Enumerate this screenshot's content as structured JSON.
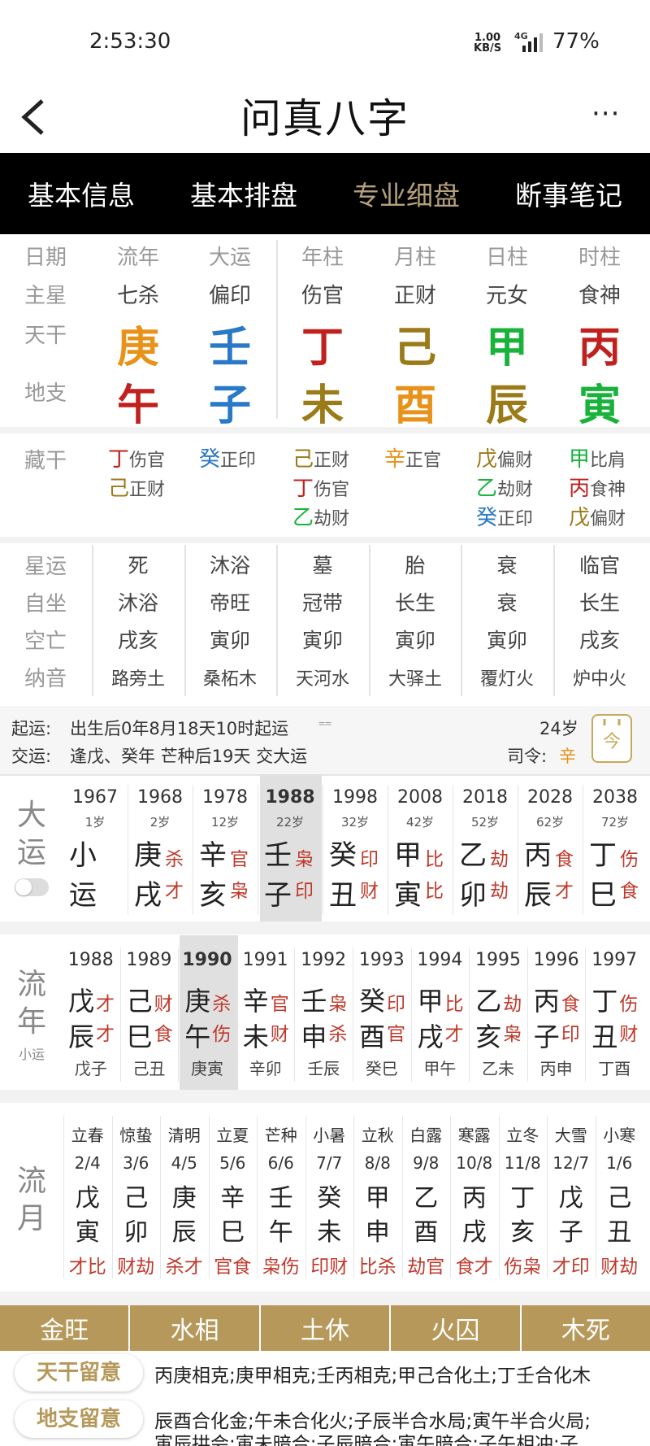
{
  "status": {
    "time": "2:53:30",
    "net_top": "1.00",
    "net_bottom": "KB/S",
    "net_type": "4G",
    "battery": "77%"
  },
  "header": {
    "title": "问真八字",
    "more": "···"
  },
  "tabs": [
    {
      "label": "基本信息"
    },
    {
      "label": "基本排盘"
    },
    {
      "label": "专业细盘"
    },
    {
      "label": "断事笔记"
    }
  ],
  "grid": {
    "labels": {
      "date": "日期",
      "star": "主星",
      "gan": "天干",
      "zhi": "地支"
    },
    "columns": [
      {
        "head": "流年",
        "star": "七杀",
        "gan": "庚",
        "gan_color": "#e8921a",
        "zhi": "午",
        "zhi_color": "#c0211f"
      },
      {
        "head": "大运",
        "star": "偏印",
        "gan": "壬",
        "gan_color": "#2a78c8",
        "zhi": "子",
        "zhi_color": "#2a78c8"
      },
      {
        "head": "年柱",
        "star": "伤官",
        "gan": "丁",
        "gan_color": "#c0211f",
        "zhi": "未",
        "zhi_color": "#9a7b18"
      },
      {
        "head": "月柱",
        "star": "正财",
        "gan": "己",
        "gan_color": "#9a7b18",
        "zhi": "酉",
        "zhi_color": "#e8921a"
      },
      {
        "head": "日柱",
        "star": "元女",
        "gan": "甲",
        "gan_color": "#19b33b",
        "zhi": "辰",
        "zhi_color": "#9a7b18"
      },
      {
        "head": "时柱",
        "star": "食神",
        "gan": "丙",
        "gan_color": "#c0211f",
        "zhi": "寅",
        "zhi_color": "#19b33b"
      }
    ]
  },
  "hidden": {
    "label": "藏干",
    "columns": [
      [
        {
          "g": "丁",
          "c": "#c0211f",
          "s": "伤官"
        },
        {
          "g": "己",
          "c": "#9a7b18",
          "s": "正财"
        }
      ],
      [
        {
          "g": "癸",
          "c": "#2a78c8",
          "s": "正印"
        }
      ],
      [
        {
          "g": "己",
          "c": "#9a7b18",
          "s": "正财"
        },
        {
          "g": "丁",
          "c": "#c0211f",
          "s": "伤官"
        },
        {
          "g": "乙",
          "c": "#19b33b",
          "s": "劫财"
        }
      ],
      [
        {
          "g": "辛",
          "c": "#e8921a",
          "s": "正官"
        }
      ],
      [
        {
          "g": "戊",
          "c": "#9a7b18",
          "s": "偏财"
        },
        {
          "g": "乙",
          "c": "#19b33b",
          "s": "劫财"
        },
        {
          "g": "癸",
          "c": "#2a78c8",
          "s": "正印"
        }
      ],
      [
        {
          "g": "甲",
          "c": "#19b33b",
          "s": "比肩"
        },
        {
          "g": "丙",
          "c": "#c0211f",
          "s": "食神"
        },
        {
          "g": "戊",
          "c": "#9a7b18",
          "s": "偏财"
        }
      ]
    ]
  },
  "stars": {
    "labels": [
      "星运",
      "自坐",
      "空亡",
      "纳音"
    ],
    "rows": [
      [
        "死",
        "沐浴",
        "墓",
        "胎",
        "衰",
        "临官"
      ],
      [
        "沐浴",
        "帝旺",
        "冠带",
        "长生",
        "衰",
        "长生"
      ],
      [
        "戌亥",
        "寅卯",
        "寅卯",
        "寅卯",
        "寅卯",
        "戌亥"
      ],
      [
        "路旁土",
        "桑柘木",
        "天河水",
        "大驿土",
        "覆灯火",
        "炉中火"
      ]
    ]
  },
  "qiyun": {
    "l1_label": "起运:",
    "l1_text": "出生后0年8月18天10时起运",
    "l1_mark": "⩵",
    "age": "24岁",
    "l2_label": "交运:",
    "l2_text": "逢戊、癸年 芒种后19天 交大运",
    "siling_label": "司令:",
    "siling": "辛",
    "today_icon": "calendar-today-icon",
    "today_label": "今"
  },
  "dayun": {
    "side": [
      "大",
      "运"
    ],
    "items": [
      {
        "year": "1967",
        "age": "1岁",
        "g": "小",
        "z": "运",
        "gs": "",
        "zs": ""
      },
      {
        "year": "1968",
        "age": "2岁",
        "g": "庚",
        "z": "戌",
        "gs": "杀",
        "zs": "才"
      },
      {
        "year": "1978",
        "age": "12岁",
        "g": "辛",
        "z": "亥",
        "gs": "官",
        "zs": "枭"
      },
      {
        "year": "1988",
        "age": "22岁",
        "g": "壬",
        "z": "子",
        "gs": "枭",
        "zs": "印"
      },
      {
        "year": "1998",
        "age": "32岁",
        "g": "癸",
        "z": "丑",
        "gs": "印",
        "zs": "财"
      },
      {
        "year": "2008",
        "age": "42岁",
        "g": "甲",
        "z": "寅",
        "gs": "比",
        "zs": "比"
      },
      {
        "year": "2018",
        "age": "52岁",
        "g": "乙",
        "z": "卯",
        "gs": "劫",
        "zs": "劫"
      },
      {
        "year": "2028",
        "age": "62岁",
        "g": "丙",
        "z": "辰",
        "gs": "食",
        "zs": "才"
      },
      {
        "year": "2038",
        "age": "72岁",
        "g": "丁",
        "z": "巳",
        "gs": "伤",
        "zs": "食"
      }
    ]
  },
  "liunian": {
    "side": [
      "流",
      "年"
    ],
    "side_sub": "小运",
    "items": [
      {
        "year": "1988",
        "g": "戊",
        "z": "辰",
        "gs": "才",
        "zs": "才",
        "x": "戊子"
      },
      {
        "year": "1989",
        "g": "己",
        "z": "巳",
        "gs": "财",
        "zs": "食",
        "x": "己丑"
      },
      {
        "year": "1990",
        "g": "庚",
        "z": "午",
        "gs": "杀",
        "zs": "伤",
        "x": "庚寅"
      },
      {
        "year": "1991",
        "g": "辛",
        "z": "未",
        "gs": "官",
        "zs": "财",
        "x": "辛卯"
      },
      {
        "year": "1992",
        "g": "壬",
        "z": "申",
        "gs": "枭",
        "zs": "杀",
        "x": "壬辰"
      },
      {
        "year": "1993",
        "g": "癸",
        "z": "酉",
        "gs": "印",
        "zs": "官",
        "x": "癸巳"
      },
      {
        "year": "1994",
        "g": "甲",
        "z": "戌",
        "gs": "比",
        "zs": "才",
        "x": "甲午"
      },
      {
        "year": "1995",
        "g": "乙",
        "z": "亥",
        "gs": "劫",
        "zs": "枭",
        "x": "乙未"
      },
      {
        "year": "1996",
        "g": "丙",
        "z": "子",
        "gs": "食",
        "zs": "印",
        "x": "丙申"
      },
      {
        "year": "1997",
        "g": "丁",
        "z": "丑",
        "gs": "伤",
        "zs": "财",
        "x": "丁酉"
      }
    ]
  },
  "liuyue": {
    "side": [
      "流",
      "月"
    ],
    "items": [
      {
        "jq": "立春",
        "d": "2/4",
        "g": "戊",
        "z": "寅",
        "s": "才比"
      },
      {
        "jq": "惊蛰",
        "d": "3/6",
        "g": "己",
        "z": "卯",
        "s": "财劫"
      },
      {
        "jq": "清明",
        "d": "4/5",
        "g": "庚",
        "z": "辰",
        "s": "杀才"
      },
      {
        "jq": "立夏",
        "d": "5/6",
        "g": "辛",
        "z": "巳",
        "s": "官食"
      },
      {
        "jq": "芒种",
        "d": "6/6",
        "g": "壬",
        "z": "午",
        "s": "枭伤"
      },
      {
        "jq": "小暑",
        "d": "7/7",
        "g": "癸",
        "z": "未",
        "s": "印财"
      },
      {
        "jq": "立秋",
        "d": "8/8",
        "g": "甲",
        "z": "申",
        "s": "比杀"
      },
      {
        "jq": "白露",
        "d": "9/8",
        "g": "乙",
        "z": "酉",
        "s": "劫官"
      },
      {
        "jq": "寒露",
        "d": "10/8",
        "g": "丙",
        "z": "戌",
        "s": "食才"
      },
      {
        "jq": "立冬",
        "d": "11/8",
        "g": "丁",
        "z": "亥",
        "s": "伤枭"
      },
      {
        "jq": "大雪",
        "d": "12/7",
        "g": "戊",
        "z": "子",
        "s": "才印"
      },
      {
        "jq": "小寒",
        "d": "1/6",
        "g": "己",
        "z": "丑",
        "s": "财劫"
      }
    ]
  },
  "wang": [
    "金旺",
    "水相",
    "土休",
    "火囚",
    "木死"
  ],
  "notes": {
    "tiangan_label": "天干留意",
    "tiangan_text": "丙庚相克;庚甲相克;壬丙相克;甲己合化土;丁壬合化木",
    "dizhi_label": "地支留意",
    "dizhi_text1": "辰酉合化金;午未合化火;子辰半合水局;寅午半合火局;",
    "dizhi_text2": "寅辰拱会;寅未暗合;子辰暗合;寅午暗合;子午相冲;子"
  }
}
